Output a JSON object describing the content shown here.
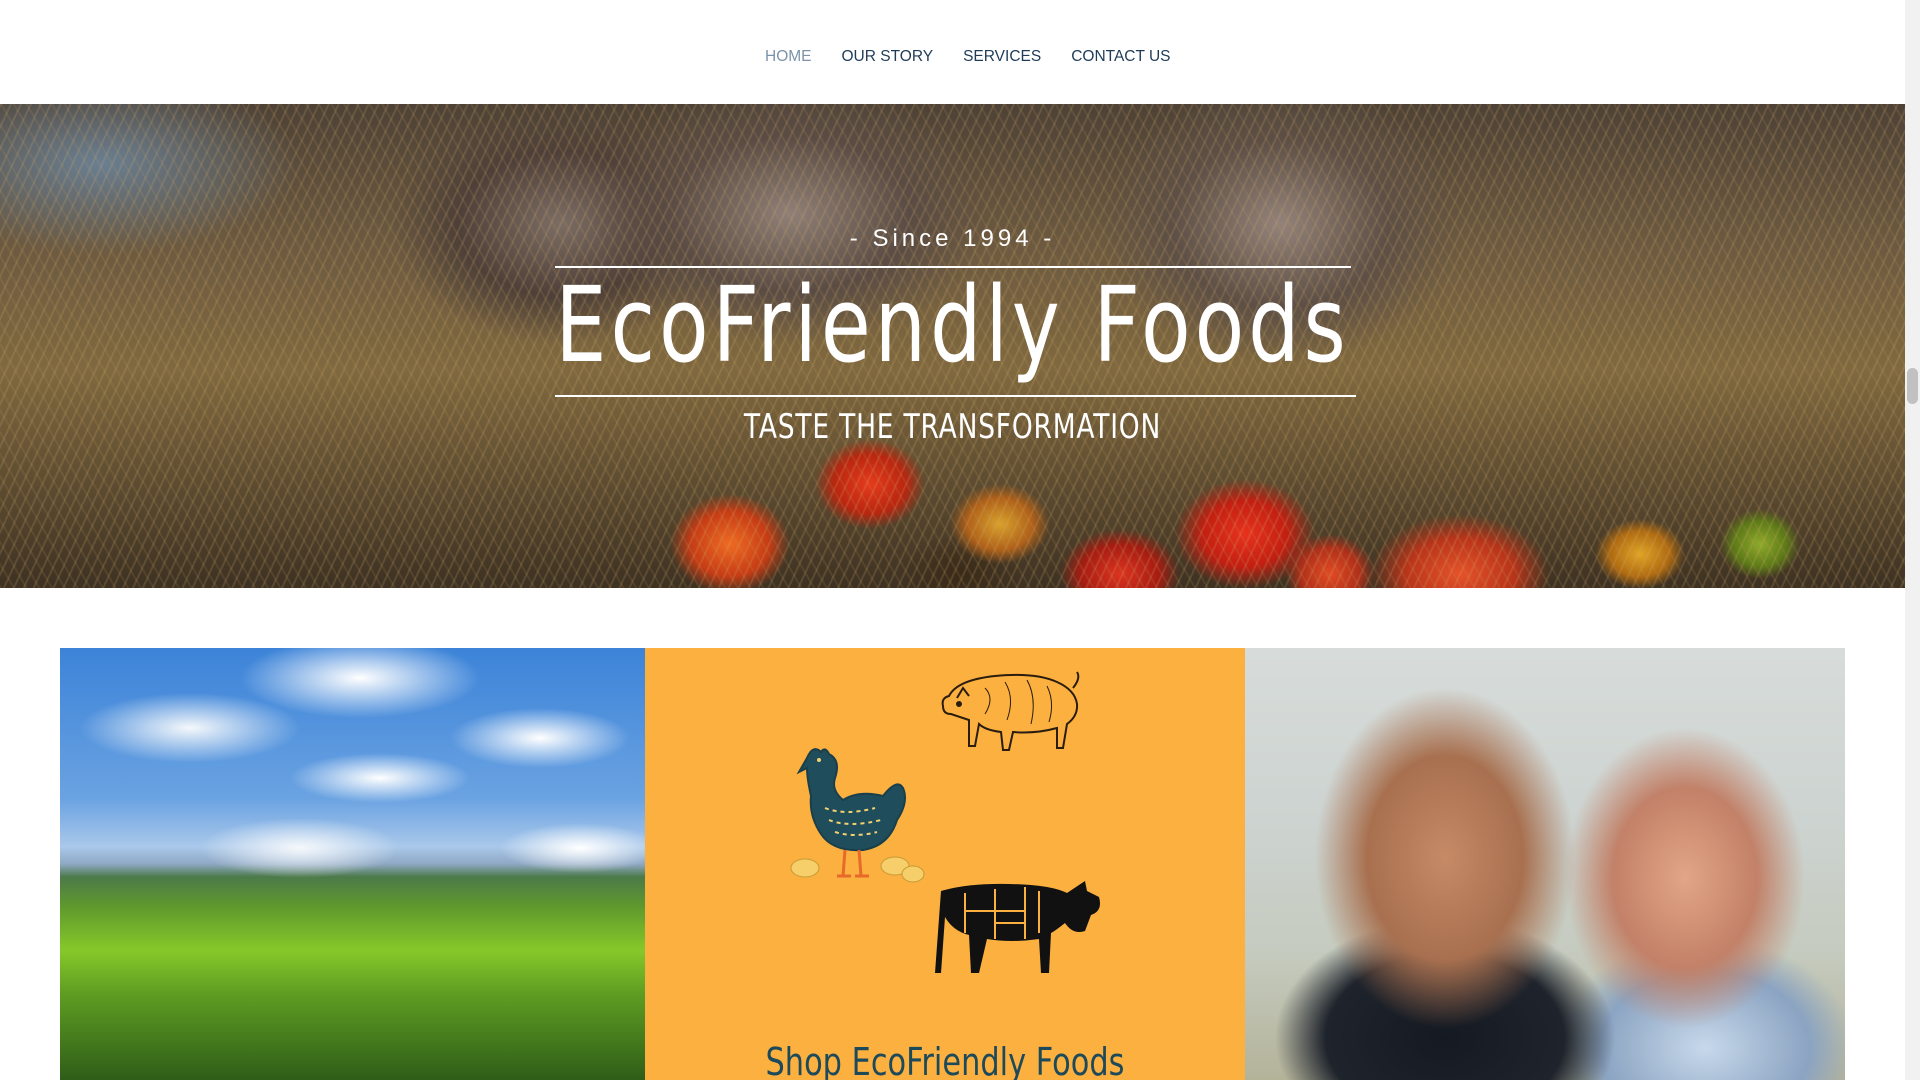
{
  "nav": {
    "items": [
      {
        "label": "HOME",
        "active": true
      },
      {
        "label": "OUR STORY",
        "active": false
      },
      {
        "label": "SERVICES",
        "active": false
      },
      {
        "label": "CONTACT US",
        "active": false
      }
    ]
  },
  "hero": {
    "since": "- Since 1994 -",
    "title": "EcoFriendly Foods",
    "tagline": "TASTE THE TRANSFORMATION",
    "image": "pigs-and-tomatoes-photo"
  },
  "gallery": {
    "left_image": "mountain-landscape-photo",
    "center_title": "Shop EcoFriendly Foods",
    "center_icons": [
      "pig-icon",
      "chicken-icon",
      "cow-icon"
    ],
    "right_image": "father-daughter-photo"
  },
  "colors": {
    "nav_text": "#1f3b57",
    "nav_active": "#7b93a8",
    "shop_panel": "#fbb040",
    "shop_title": "#1d4a5a"
  }
}
